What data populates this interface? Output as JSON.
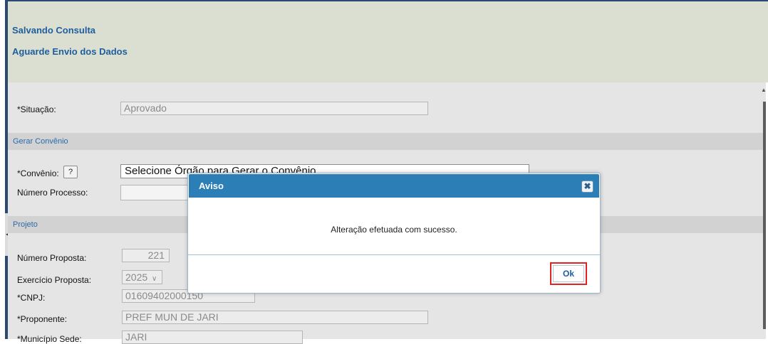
{
  "header": {
    "line1": "Salvando Consulta",
    "line2": "Aguarde Envio dos Dados"
  },
  "form": {
    "situacao_label": "*Situação:",
    "situacao_value": "Aprovado",
    "section_gerar": "Gerar Convênio",
    "convenio_label": "*Convênio:",
    "help_label": "?",
    "convenio_select_value": "Selecione Órgão para Gerar o Convênio",
    "numero_processo_label": "Número Processo:",
    "section_projeto": "Projeto",
    "numero_proposta_label": "Número Proposta:",
    "numero_proposta_value": "221",
    "exercicio_label": "Exercício Proposta:",
    "exercicio_value": "2025",
    "cnpj_label": "*CNPJ:",
    "cnpj_value": "01609402000150",
    "proponente_label": "*Proponente:",
    "proponente_value": "PREF MUN DE JARI",
    "municipio_label": "*Município Sede:",
    "municipio_value": "JARI"
  },
  "dialog": {
    "title": "Aviso",
    "message": "Alteração efetuada com sucesso.",
    "ok_label": "Ok"
  },
  "colors": {
    "header_bg": "#dadfd2",
    "dialog_title_bg": "#2b7fb6",
    "link_blue": "#1f5e9c",
    "highlight_red": "#e32323"
  }
}
